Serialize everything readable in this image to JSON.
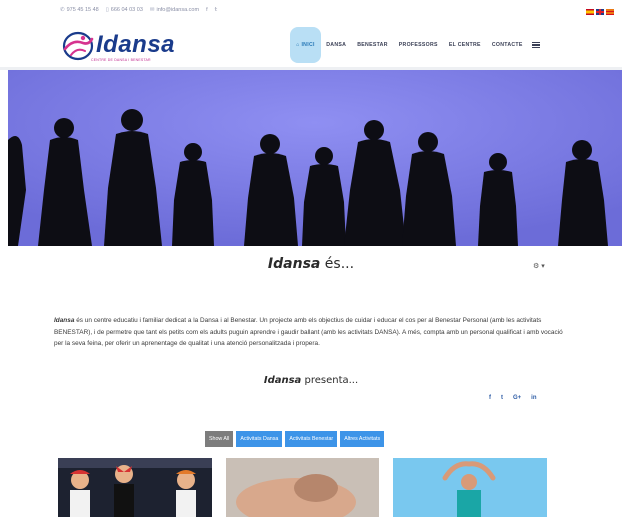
{
  "topbar": {
    "phone1": "975 45 15 48",
    "phone2": "666 04 03 03",
    "email": "info@idansa.com",
    "social": [
      "f",
      "tw"
    ],
    "languages": [
      "es",
      "en",
      "ca"
    ]
  },
  "brand": {
    "name": "Idansa",
    "tagline": "CENTRE DE DANSA I BENESTAR",
    "color": "#1a3b8b",
    "accent": "#c0298e"
  },
  "nav": {
    "items": [
      {
        "label": "INICI",
        "active": true
      },
      {
        "label": "DANSA"
      },
      {
        "label": "BENESTAR"
      },
      {
        "label": "PROFESSORS"
      },
      {
        "label": "EL CENTRE"
      },
      {
        "label": "CONTACTE"
      }
    ],
    "active_color": "#b9dff5"
  },
  "hero": {
    "background": "#7f7fe6"
  },
  "about": {
    "title_brand": "Idansa",
    "title_rest": " és...",
    "settings_caret": "▾",
    "intro_brand": "Idansa",
    "intro_text": " és un centre educatiu i familiar dedicat a la Dansa i al Benestar. Un projecte amb els objectius de cuidar i educar el cos per al Benestar Personal (amb les activitats BENESTAR), i de permetre que tant els petits com els adults puguin aprendre i gaudir ballant (amb les activitats DANSA). A més, compta amb un personal qualificat i amb vocació per la seva feina, per oferir un aprenentage de qualitat i una atenció personalitzada i propera."
  },
  "presenta": {
    "brand": "Idansa",
    "rest": " presenta...",
    "social": [
      "f",
      "t",
      "G+",
      "in"
    ]
  },
  "filters": [
    {
      "label": "Show All",
      "active": true
    },
    {
      "label": "Activitats Dansa"
    },
    {
      "label": "Activitats Benestar"
    },
    {
      "label": "Altres Activitats"
    }
  ]
}
